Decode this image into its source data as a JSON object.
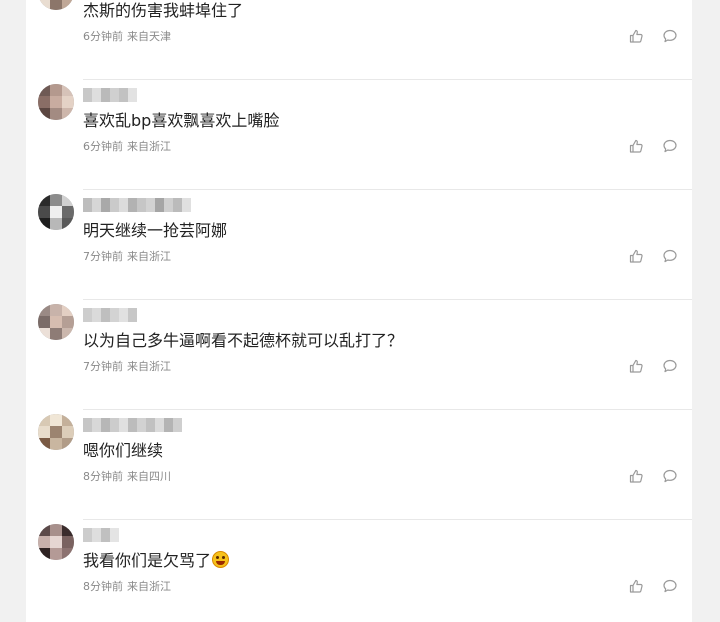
{
  "comments": [
    {
      "text": "杰斯的伤害我蚌埠住了",
      "time": "6分钟前",
      "location": "来自天津",
      "has_emoji": false,
      "avatar_colors": [
        "#c9b4a6",
        "#e2d4c8",
        "#a38a7a",
        "#7a6458",
        "#d8c3b3",
        "#b59c8c",
        "#e9ddd1",
        "#8c766a",
        "#c0a898"
      ],
      "name_colors": [
        "#d4d4d4",
        "#bdbdbd",
        "#cfcfcf",
        "#b3b3b3",
        "#d9d9d9",
        "#c4c4c4",
        "#e0e0e0"
      ]
    },
    {
      "text": "喜欢乱bp喜欢飘喜欢上嘴脸",
      "time": "6分钟前",
      "location": "来自浙江",
      "has_emoji": false,
      "avatar_colors": [
        "#6f5a55",
        "#b4998e",
        "#d6c2b8",
        "#8a6e66",
        "#c8aca0",
        "#e4d2c6",
        "#5b4641",
        "#a38b82",
        "#cdb6ab"
      ],
      "name_colors": [
        "#c8c8c8",
        "#dedede",
        "#bababa",
        "#d0d0d0",
        "#c2c2c2",
        "#e2e2e2"
      ]
    },
    {
      "text": "明天继续一抢芸阿娜",
      "time": "7分钟前",
      "location": "来自浙江",
      "has_emoji": false,
      "avatar_colors": [
        "#2b2b2b",
        "#8c8c8c",
        "#d0d0d0",
        "#4a4a4a",
        "#efefef",
        "#6a6a6a",
        "#1e1e1e",
        "#b8b8b8",
        "#595959"
      ],
      "name_colors": [
        "#bdbdbd",
        "#d6d6d6",
        "#a9a9a9",
        "#cacaca",
        "#dcdcdc",
        "#b2b2b2",
        "#c6c6c6",
        "#d2d2d2",
        "#a5a5a5",
        "#cfcfcf",
        "#bbbbbb",
        "#e0e0e0"
      ]
    },
    {
      "text": "以为自己多牛逼啊看不起德杯就可以乱打了？",
      "time": "7分钟前",
      "location": "来自浙江",
      "has_emoji": false,
      "avatar_colors": [
        "#9a8a85",
        "#c8b3aa",
        "#e3cfc3",
        "#7b6c68",
        "#d6bdb0",
        "#b59f95",
        "#ece0d8",
        "#8e7c76",
        "#cbb7ad"
      ],
      "name_colors": [
        "#cdcdcd",
        "#dadada",
        "#bfbfbf",
        "#d3d3d3",
        "#e1e1e1",
        "#c7c7c7"
      ]
    },
    {
      "text": "嗯你们继续",
      "time": "8分钟前",
      "location": "来自四川",
      "has_emoji": false,
      "avatar_colors": [
        "#d8c9b4",
        "#f0e6d6",
        "#c4b09a",
        "#e8dccb",
        "#9c8470",
        "#dccdb9",
        "#7a5a44",
        "#c9b6a0",
        "#b19c88"
      ],
      "name_colors": [
        "#c6c6c6",
        "#d8d8d8",
        "#b7b7b7",
        "#cccccc",
        "#e0e0e0",
        "#bcbcbc",
        "#d2d2d2",
        "#c1c1c1",
        "#dbdbdb",
        "#b4b4b4",
        "#cfcfcf"
      ]
    },
    {
      "text": "我看你们是欠骂了",
      "time": "8分钟前",
      "location": "来自浙江",
      "has_emoji": true,
      "avatar_colors": [
        "#5c4a4a",
        "#a8908c",
        "#3a2c2c",
        "#c7b0ab",
        "#e6d6d2",
        "#7a6260",
        "#2e2222",
        "#b49a96",
        "#8c7270"
      ],
      "name_colors": [
        "#cccccc",
        "#dedede",
        "#c0c0c0",
        "#e4e4e4"
      ]
    }
  ]
}
